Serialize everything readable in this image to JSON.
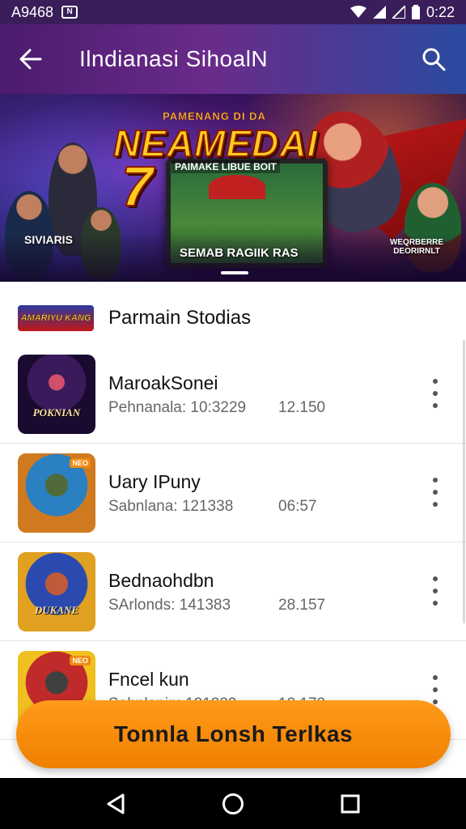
{
  "status_bar": {
    "carrier": "A9468",
    "time": "0:22",
    "notification_icon": "notification-icon",
    "icons": [
      "wifi-icon",
      "signal-icon",
      "signal-icon",
      "battery-icon"
    ]
  },
  "app_bar": {
    "title": "Ilndianasi SihoalN",
    "back_icon": "back-arrow-icon",
    "search_icon": "search-icon"
  },
  "banner": {
    "top_text": "PAMENANG DI DA",
    "title": "NEAMEDAI",
    "number": "7",
    "subtitle": "PAIMAKE LIBUE BOIT",
    "caption": "SEMAB RAGIIK RAS",
    "left_label": "SIVIARIS",
    "right_label": "WEQRBERRE DEORIRNLT"
  },
  "section": {
    "logo_text": "AMARIYU KANG",
    "title": "Parmain Stodias"
  },
  "games": [
    {
      "name": "MaroakSonei",
      "count": "Pehnanala: 10:3229",
      "value": "12.150",
      "thumb_label": "POKNIAN",
      "thumb_badge": ""
    },
    {
      "name": "Uary IPuny",
      "count": "Sabnlana: 121338",
      "value": "06:57",
      "thumb_label": "",
      "thumb_badge": "NEO"
    },
    {
      "name": "Bednaohdbn",
      "count": "SArlonds: 141383",
      "value": "28.157",
      "thumb_label": "DUKANE",
      "thumb_badge": ""
    },
    {
      "name": "Fncel kun",
      "count": "Sahnlanin: 121232",
      "value": "12.172",
      "thumb_label": "",
      "thumb_badge": "NEO"
    }
  ],
  "cta": {
    "label": "Tonnla Lonsh Terlkas"
  },
  "nav": {
    "back_icon": "nav-back-icon",
    "home_icon": "nav-home-icon",
    "recents_icon": "nav-recents-icon"
  },
  "colors": {
    "app_bar": "#5a2380",
    "cta": "#f68a0a",
    "nav_bar": "#000000"
  }
}
